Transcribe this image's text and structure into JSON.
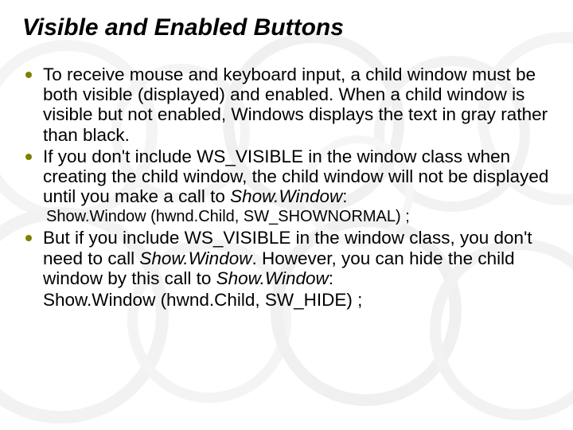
{
  "slide": {
    "title": "Visible and Enabled Buttons",
    "bullet1": "To receive mouse and keyboard input, a child window must be both visible (displayed) and enabled. When a child window is visible but not enabled, Windows displays the text in gray rather than black.",
    "bullet2_pre": "If you don't include WS_VISIBLE in the window class when creating the child window, the child window will not be displayed until you make a call to ",
    "bullet2_ital": "Show.Window",
    "bullet2_post": ":",
    "code1": "Show.Window (hwnd.Child, SW_SHOWNORMAL) ;",
    "bullet3_a": "But if you include WS_VISIBLE in the window class, you don't need to call ",
    "bullet3_b_ital": "Show.Window",
    "bullet3_c": ". However, you can hide the child window by this call to ",
    "bullet3_d_ital": "Show.Window",
    "bullet3_e": ":",
    "code2": "Show.Window (hwnd.Child, SW_HIDE) ;"
  }
}
